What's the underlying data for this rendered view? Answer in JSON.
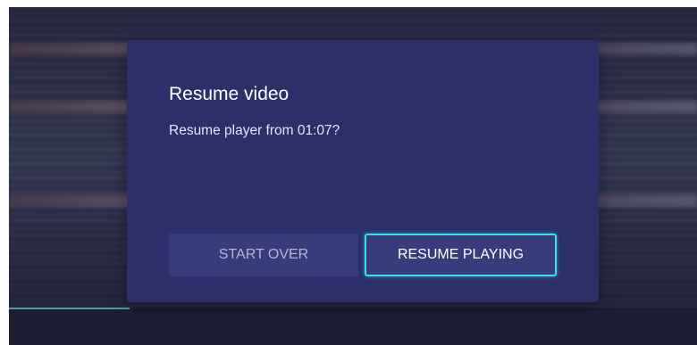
{
  "dialog": {
    "title": "Resume video",
    "message": "Resume player from 01:07?",
    "buttons": {
      "start_over": "START OVER",
      "resume_playing": "RESUME PLAYING"
    }
  },
  "colors": {
    "dialog_background": "#2c2f6a",
    "button_background": "#383c7c",
    "focus_outline": "#36e0ee"
  }
}
